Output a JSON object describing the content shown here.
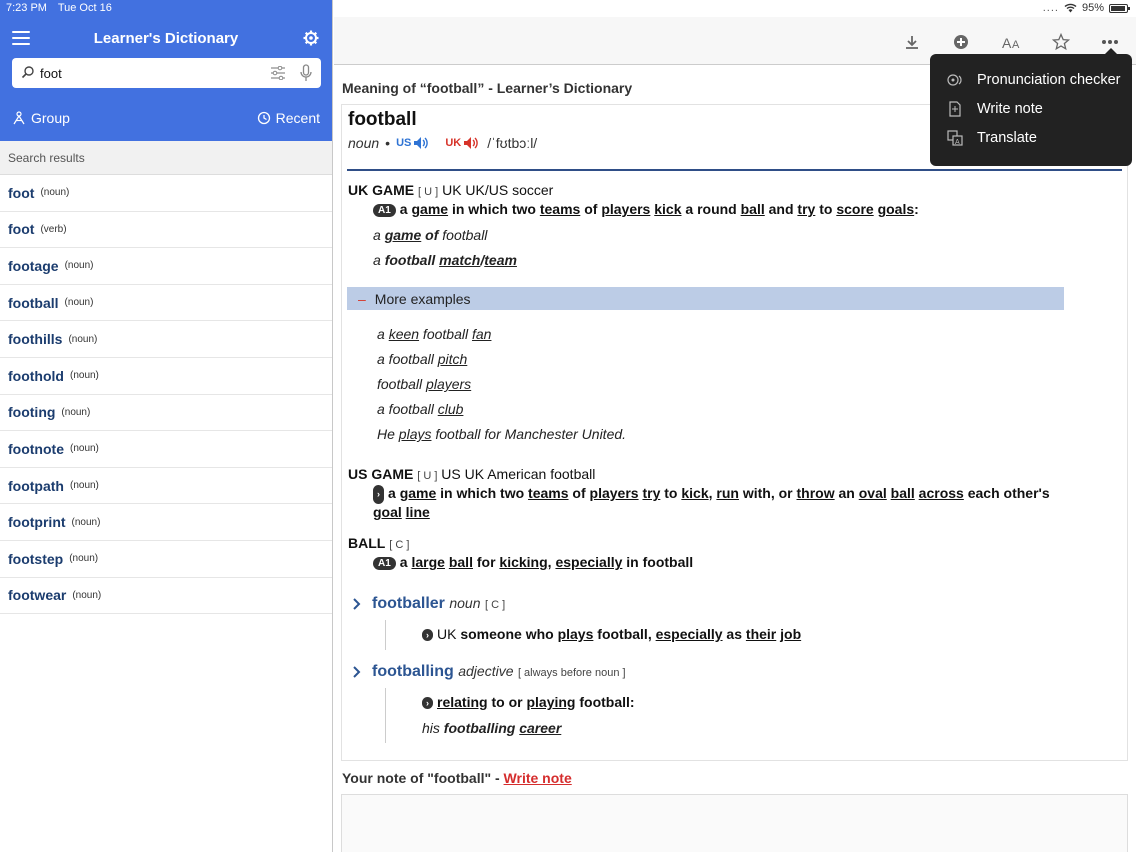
{
  "status": {
    "time": "7:23 PM",
    "date": "Tue Oct 16",
    "battery": "95%",
    "battery_level": 0.95
  },
  "sidebar": {
    "title": "Learner's Dictionary",
    "search_value": "foot",
    "group_label": "Group",
    "recent_label": "Recent",
    "results_header": "Search results",
    "results": [
      {
        "word": "foot",
        "pos": "(noun)"
      },
      {
        "word": "foot",
        "pos": "(verb)"
      },
      {
        "word": "footage",
        "pos": "(noun)"
      },
      {
        "word": "football",
        "pos": "(noun)"
      },
      {
        "word": "foothills",
        "pos": "(noun)"
      },
      {
        "word": "foothold",
        "pos": "(noun)"
      },
      {
        "word": "footing",
        "pos": "(noun)"
      },
      {
        "word": "footnote",
        "pos": "(noun)"
      },
      {
        "word": "footpath",
        "pos": "(noun)"
      },
      {
        "word": "footprint",
        "pos": "(noun)"
      },
      {
        "word": "footstep",
        "pos": "(noun)"
      },
      {
        "word": "footwear",
        "pos": "(noun)"
      }
    ]
  },
  "toolbar": {
    "icons": [
      "download-icon",
      "add-circle-icon",
      "font-size-icon",
      "star-icon",
      "more-icon"
    ]
  },
  "menu": {
    "items": [
      {
        "label": "Pronunciation checker",
        "icon": "pronunciation-icon"
      },
      {
        "label": "Write note",
        "icon": "note-icon"
      },
      {
        "label": "Translate",
        "icon": "translate-icon"
      }
    ]
  },
  "entry": {
    "meaning_title": "Meaning of “football” - Learner’s Dictionary",
    "headword": "football",
    "pos": "noun",
    "bullet": "•",
    "us_label": "US",
    "uk_label": "UK",
    "ipa": "/ˈfʊtbɔːl/",
    "senses": [
      {
        "head": "UK GAME",
        "gc": "[ U ]",
        "extra": "UK UK/US soccer",
        "level": "A1"
      },
      {
        "head": "US GAME",
        "gc": "[ U ]",
        "extra": "US UK American football"
      },
      {
        "head": "BALL",
        "gc": "[ C ]",
        "level": "A1"
      }
    ],
    "more_examples_label": "More examples",
    "more_examples_toggle": "–",
    "derivatives": [
      {
        "word": "footballer",
        "pos": "noun",
        "gc": "[ C ]"
      },
      {
        "word": "footballing",
        "pos": "adjective",
        "gc": "[ always before noun ]"
      }
    ],
    "note_title": "Your note of \"football\" - ",
    "note_link": "Write note"
  },
  "colors": {
    "brand_blue": "#4271e0",
    "headword_link": "#2c5592",
    "us_blue": "#2e73d4",
    "uk_red": "#d7342a",
    "more_bar": "#bccce6",
    "menu_bg": "#222222"
  }
}
